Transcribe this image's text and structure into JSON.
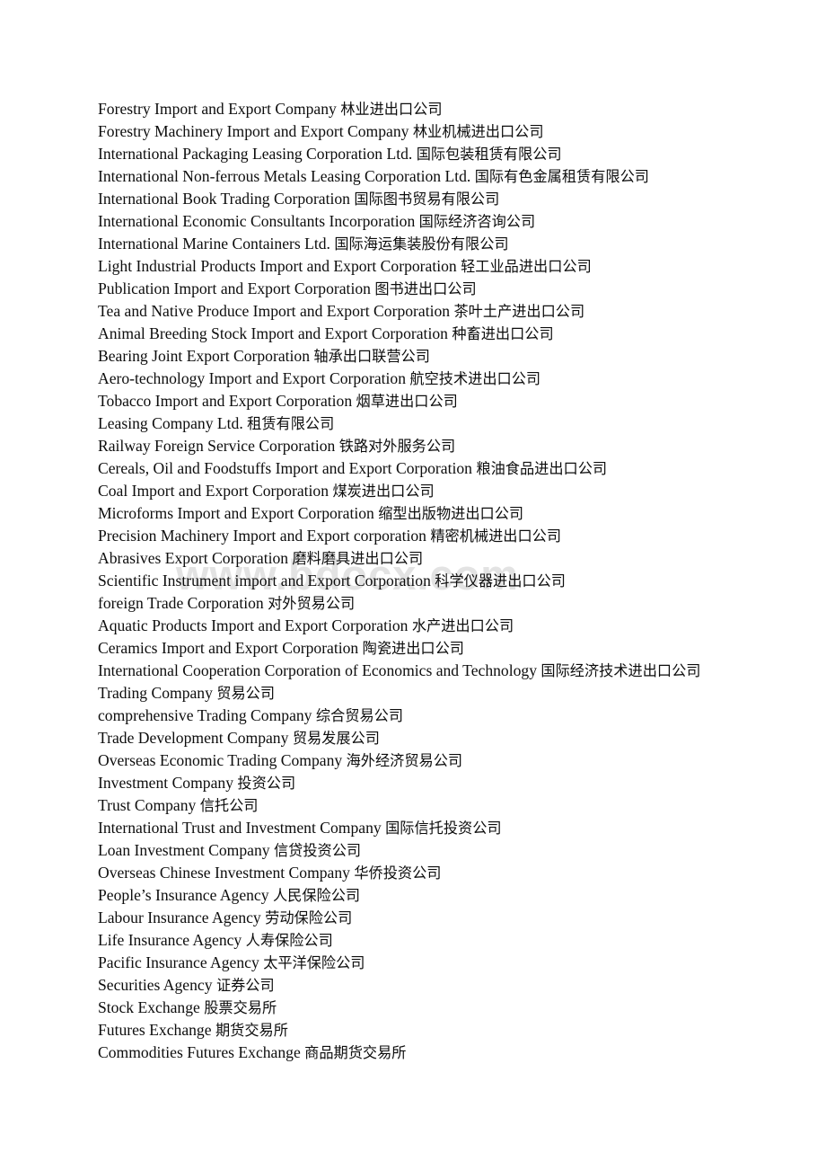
{
  "watermark": {
    "text": "www.bdocx.com",
    "color": "#e3e3e3"
  },
  "document": {
    "text_color": "#0d0d0d",
    "background_color": "#ffffff",
    "entries": [
      {
        "en": "Forestry Import and Export Company",
        "zh": "林业进出口公司"
      },
      {
        "en": "Forestry Machinery Import and Export Company",
        "zh": "林业机械进出口公司"
      },
      {
        "en": "International Packaging Leasing Corporation Ltd.",
        "zh": "国际包装租赁有限公司"
      },
      {
        "en": "International Non-ferrous Metals Leasing Corporation Ltd.",
        "zh": "国际有色金属租赁有限公司"
      },
      {
        "en": "International Book Trading Corporation",
        "zh": "国际图书贸易有限公司"
      },
      {
        "en": "International Economic Consultants Incorporation",
        "zh": "国际经济咨询公司"
      },
      {
        "en": "International Marine Containers Ltd.",
        "zh": "国际海运集装股份有限公司"
      },
      {
        "en": "Light Industrial Products Import and Export Corporation",
        "zh": "轻工业品进出口公司"
      },
      {
        "en": "Publication Import and Export Corporation",
        "zh": "图书进出口公司"
      },
      {
        "en": "Tea and Native Produce Import and Export Corporation",
        "zh": "茶叶土产进出口公司"
      },
      {
        "en": "Animal Breeding Stock Import and Export Corporation",
        "zh": "种畜进出口公司"
      },
      {
        "en": "Bearing Joint Export Corporation",
        "zh": "轴承出口联营公司"
      },
      {
        "en": "Aero-technology Import and Export Corporation",
        "zh": "航空技术进出口公司"
      },
      {
        "en": "Tobacco Import and Export Corporation",
        "zh": "烟草进出口公司"
      },
      {
        "en": "Leasing Company Ltd.",
        "zh": "租赁有限公司"
      },
      {
        "en": "Railway Foreign Service Corporation",
        "zh": "铁路对外服务公司"
      },
      {
        "en": "Cereals, Oil and Foodstuffs Import and Export Corporation",
        "zh": "粮油食品进出口公司"
      },
      {
        "en": "Coal Import and Export Corporation",
        "zh": "煤炭进出口公司"
      },
      {
        "en": "Microforms Import and Export Corporation",
        "zh": "缩型出版物进出口公司"
      },
      {
        "en": "Precision Machinery Import and Export corporation",
        "zh": "精密机械进出口公司"
      },
      {
        "en": "Abrasives Export Corporation",
        "zh": "磨料磨具进出口公司"
      },
      {
        "en": "Scientific Instrument import and Export Corporation",
        "zh": "科学仪器进出口公司"
      },
      {
        "en": "foreign Trade Corporation",
        "zh": "对外贸易公司"
      },
      {
        "en": "Aquatic Products Import and Export Corporation",
        "zh": "水产进出口公司"
      },
      {
        "en": "Ceramics Import and Export Corporation",
        "zh": "陶瓷进出口公司"
      },
      {
        "en": "International Cooperation Corporation of Economics and Technology",
        "zh": "国际经济技术进出口公司"
      },
      {
        "en": "Trading Company",
        "zh": "贸易公司"
      },
      {
        "en": "comprehensive Trading Company",
        "zh": "综合贸易公司"
      },
      {
        "en": "Trade Development Company",
        "zh": "贸易发展公司"
      },
      {
        "en": "Overseas Economic Trading Company",
        "zh": "海外经济贸易公司"
      },
      {
        "en": "Investment Company",
        "zh": "投资公司"
      },
      {
        "en": "Trust Company",
        "zh": "信托公司"
      },
      {
        "en": "International Trust and Investment Company",
        "zh": "国际信托投资公司"
      },
      {
        "en": "Loan Investment Company",
        "zh": "信贷投资公司"
      },
      {
        "en": "Overseas Chinese Investment Company",
        "zh": "华侨投资公司"
      },
      {
        "en": "People’s Insurance Agency",
        "zh": "人民保险公司"
      },
      {
        "en": "Labour Insurance Agency",
        "zh": "劳动保险公司"
      },
      {
        "en": "Life Insurance Agency",
        "zh": "人寿保险公司"
      },
      {
        "en": "Pacific Insurance Agency",
        "zh": "太平洋保险公司"
      },
      {
        "en": "Securities Agency",
        "zh": "证券公司"
      },
      {
        "en": "Stock Exchange",
        "zh": "股票交易所"
      },
      {
        "en": "Futures Exchange",
        "zh": "期货交易所"
      },
      {
        "en": "Commodities Futures Exchange",
        "zh": "商品期货交易所"
      }
    ]
  }
}
